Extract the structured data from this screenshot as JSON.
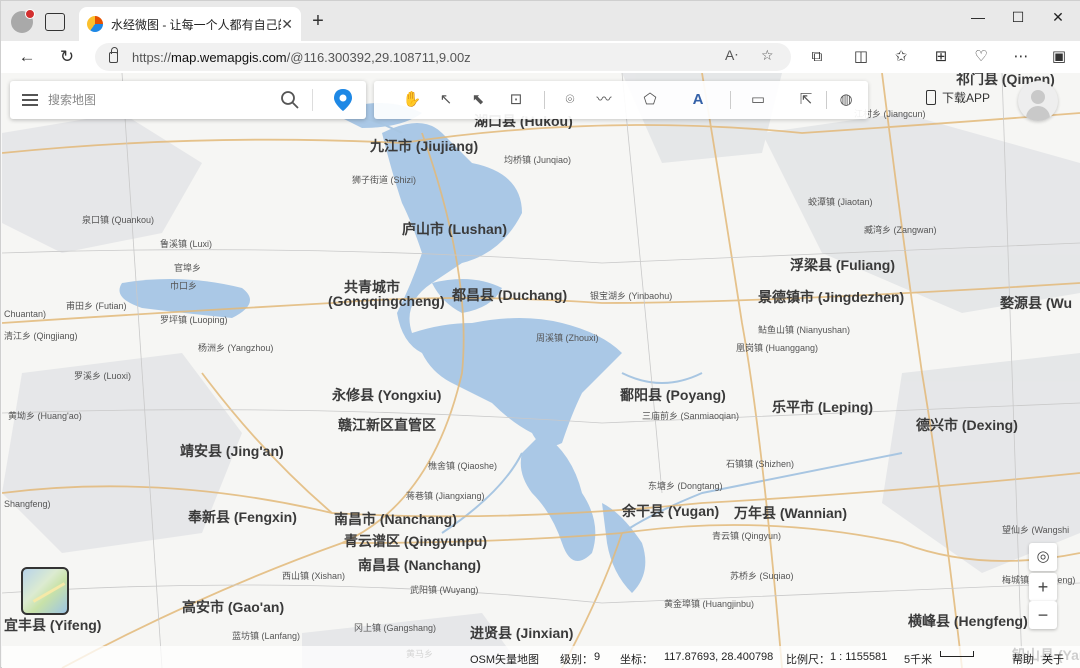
{
  "browser": {
    "tab_title": "水经微图 - 让每一个人都有自己的",
    "url_prefix": "https://",
    "url_host": "map.wemapgis.com",
    "url_rest": "/@116.300392,29.108711,9.00z",
    "icons": [
      "profile-icon",
      "tab-actions-icon",
      "close-icon",
      "new-tab-icon",
      "minimize-icon",
      "maximize-icon",
      "close-window-icon",
      "back-icon",
      "refresh-icon",
      "lock-icon",
      "read-aloud-icon",
      "favorite-icon",
      "extensions-icon",
      "split-screen-icon",
      "favorites-icon",
      "collections-icon",
      "browser-essentials-icon",
      "more-icon",
      "sidebar-icon"
    ]
  },
  "search": {
    "placeholder": "搜索地图"
  },
  "top_right": {
    "download_label": "下载APP"
  },
  "zoom": {
    "in": "+",
    "out": "−"
  },
  "statusbar": {
    "source": "OSM矢量地图",
    "level_label": "级别：",
    "level_value": "9",
    "coord_label": "坐标：",
    "coord_value": "117.87693, 28.400798",
    "scale_label": "比例尺：",
    "scale_value": "1 : 1155581",
    "scale_bar_label": "5千米",
    "help": "帮助",
    "about": "关于"
  },
  "places": [
    {
      "id": "hukou",
      "text": "湖口县 (Hukou)",
      "cls": "big"
    },
    {
      "id": "jiujiang",
      "text": "九江市 (Jiujiang)",
      "cls": "big"
    },
    {
      "id": "junqiao",
      "text": "均桥镇 (Junqiao)",
      "cls": "small"
    },
    {
      "id": "shizi",
      "text": "狮子街道 (Shizi)",
      "cls": "small"
    },
    {
      "id": "quankou",
      "text": "泉口镇 (Quankou)",
      "cls": "small"
    },
    {
      "id": "lushan",
      "text": "庐山市 (Lushan)",
      "cls": "big"
    },
    {
      "id": "luxi",
      "text": "鲁溪镇 (Luxi)",
      "cls": "small"
    },
    {
      "id": "guanting",
      "text": "官埠乡",
      "cls": "small"
    },
    {
      "id": "kukou",
      "text": "巾口乡",
      "cls": "small"
    },
    {
      "id": "gongqing",
      "text": "共青城市",
      "cls": "big"
    },
    {
      "id": "gongqing_en",
      "text": "(Gongqingcheng)",
      "cls": "big"
    },
    {
      "id": "duchang",
      "text": "都昌县 (Duchang)",
      "cls": "big"
    },
    {
      "id": "yinbaohu",
      "text": "银宝湖乡 (Yinbaohu)",
      "cls": "small"
    },
    {
      "id": "futian",
      "text": "甫田乡 (Futian)",
      "cls": "small"
    },
    {
      "id": "luoping",
      "text": "罗坪镇 (Luoping)",
      "cls": "small"
    },
    {
      "id": "yangzhou",
      "text": "杨洲乡 (Yangzhou)",
      "cls": "small"
    },
    {
      "id": "zhouxi",
      "text": "周溪镇 (Zhouxi)",
      "cls": "small"
    },
    {
      "id": "qingjiang",
      "text": "清江乡 (Qingjiang)",
      "cls": "small"
    },
    {
      "id": "luoxi",
      "text": "罗溪乡 (Luoxi)",
      "cls": "small"
    },
    {
      "id": "yongxiu",
      "text": "永修县 (Yongxiu)",
      "cls": "big"
    },
    {
      "id": "ganjiang",
      "text": "赣江新区直管区",
      "cls": "big"
    },
    {
      "id": "huang_ao",
      "text": "黄坳乡 (Huang'ao)",
      "cls": "small"
    },
    {
      "id": "jingan",
      "text": "靖安县 (Jing'an)",
      "cls": "big"
    },
    {
      "id": "qiaoshe",
      "text": "樵舍镇 (Qiaoshe)",
      "cls": "small"
    },
    {
      "id": "jiangxiang",
      "text": "蒋巷镇 (Jiangxiang)",
      "cls": "small"
    },
    {
      "id": "fengxin",
      "text": "奉新县 (Fengxin)",
      "cls": "big"
    },
    {
      "id": "nanchang_city",
      "text": "南昌市 (Nanchang)",
      "cls": "big"
    },
    {
      "id": "qingyunpu",
      "text": "青云谱区 (Qingyunpu)",
      "cls": "big"
    },
    {
      "id": "nanchang_county",
      "text": "南昌县 (Nanchang)",
      "cls": "big"
    },
    {
      "id": "xishan",
      "text": "西山镇 (Xishan)",
      "cls": "small"
    },
    {
      "id": "wuyang",
      "text": "武阳镇 (Wuyang)",
      "cls": "small"
    },
    {
      "id": "gaoan",
      "text": "高安市 (Gao'an)",
      "cls": "big"
    },
    {
      "id": "lanfang",
      "text": "蓝坊镇 (Lanfang)",
      "cls": "small"
    },
    {
      "id": "gangshang",
      "text": "冈上镇 (Gangshang)",
      "cls": "small"
    },
    {
      "id": "jinxian",
      "text": "进贤县 (Jinxian)",
      "cls": "big"
    },
    {
      "id": "yifeng",
      "text": "宜丰县 (Yifeng)",
      "cls": "big"
    },
    {
      "id": "huangma",
      "text": "黄马乡",
      "cls": "small"
    },
    {
      "id": "poyang",
      "text": "鄱阳县 (Poyang)",
      "cls": "big"
    },
    {
      "id": "sanmiaoqian",
      "text": "三庙前乡 (Sanmiaoqian)",
      "cls": "small"
    },
    {
      "id": "leping",
      "text": "乐平市 (Leping)",
      "cls": "big"
    },
    {
      "id": "shizhen",
      "text": "石镇镇 (Shizhen)",
      "cls": "small"
    },
    {
      "id": "dongtang",
      "text": "东塘乡 (Dongtang)",
      "cls": "small"
    },
    {
      "id": "yugan",
      "text": "余干县 (Yugan)",
      "cls": "big"
    },
    {
      "id": "wannian",
      "text": "万年县 (Wannian)",
      "cls": "big"
    },
    {
      "id": "qingyun",
      "text": "青云镇 (Qingyun)",
      "cls": "small"
    },
    {
      "id": "suqiao",
      "text": "苏桥乡 (Suqiao)",
      "cls": "small"
    },
    {
      "id": "huangjinbu",
      "text": "黄金埠镇 (Huangjinbu)",
      "cls": "small"
    },
    {
      "id": "fuliang",
      "text": "浮梁县 (Fuliang)",
      "cls": "big"
    },
    {
      "id": "jingdezhen",
      "text": "景德镇市 (Jingdezhen)",
      "cls": "big"
    },
    {
      "id": "wuyuan",
      "text": "婺源县 (Wu",
      "cls": "big"
    },
    {
      "id": "nianyushan",
      "text": "鲇鱼山镇 (Nianyushan)",
      "cls": "small"
    },
    {
      "id": "huanggang",
      "text": "凰岗镇 (Huanggang)",
      "cls": "small"
    },
    {
      "id": "dexing",
      "text": "德兴市 (Dexing)",
      "cls": "big"
    },
    {
      "id": "jiaotan",
      "text": "蛟潭镇 (Jiaotan)",
      "cls": "small"
    },
    {
      "id": "zangwan",
      "text": "臧湾乡 (Zangwan)",
      "cls": "small"
    },
    {
      "id": "jiangcun",
      "text": "江村乡 (Jiangcun)",
      "cls": "small"
    },
    {
      "id": "qimen",
      "text": "祁门县 (Qimen)",
      "cls": "big"
    },
    {
      "id": "hengfeng",
      "text": "横峰县 (Hengfeng)",
      "cls": "big"
    },
    {
      "id": "wangshi",
      "text": "望仙乡 (Wangshi",
      "cls": "small"
    },
    {
      "id": "yanshan",
      "text": "铅山县 (Yanshan)",
      "cls": "big"
    },
    {
      "id": "wucheng",
      "text": "梅城镇 (Wucheng)",
      "cls": "small"
    },
    {
      "id": "shangfeng",
      "text": "Shangfeng)",
      "cls": "small"
    },
    {
      "id": "ehuan",
      "text": "Chuantan)",
      "cls": "small"
    }
  ]
}
